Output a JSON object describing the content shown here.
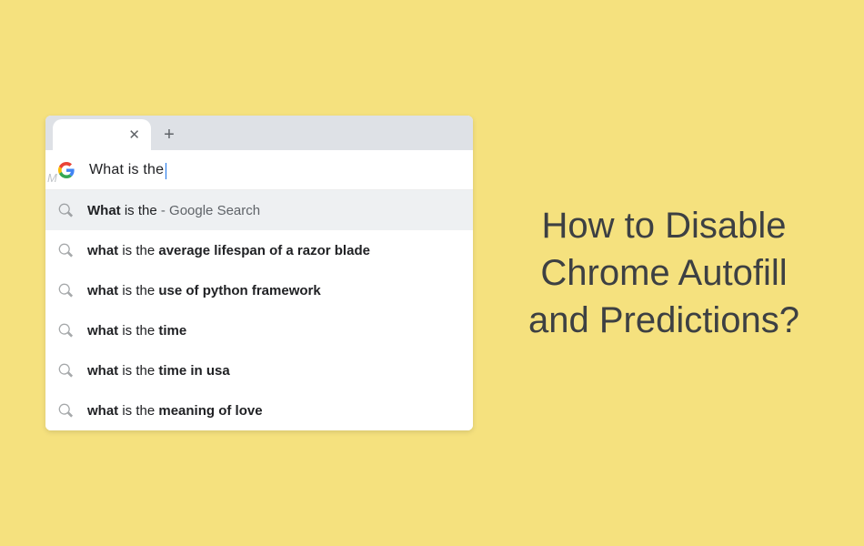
{
  "browser": {
    "query": "What is the",
    "topSuggestion": {
      "bold": "What",
      "rest": " is the",
      "source": " - Google Search"
    },
    "suggestions": [
      {
        "prefix": "what",
        "rest": " is the ",
        "bold": "average lifespan of a razor blade"
      },
      {
        "prefix": "what",
        "rest": " is the ",
        "bold": "use of python framework"
      },
      {
        "prefix": "what",
        "rest": " is the ",
        "bold": "time"
      },
      {
        "prefix": "what",
        "rest": " is the ",
        "bold": "time in usa"
      },
      {
        "prefix": "what",
        "rest": " is the ",
        "bold": "meaning of love"
      }
    ],
    "clipLabel": "M"
  },
  "headline": "How to Disable Chrome Autofill and Predictions?"
}
